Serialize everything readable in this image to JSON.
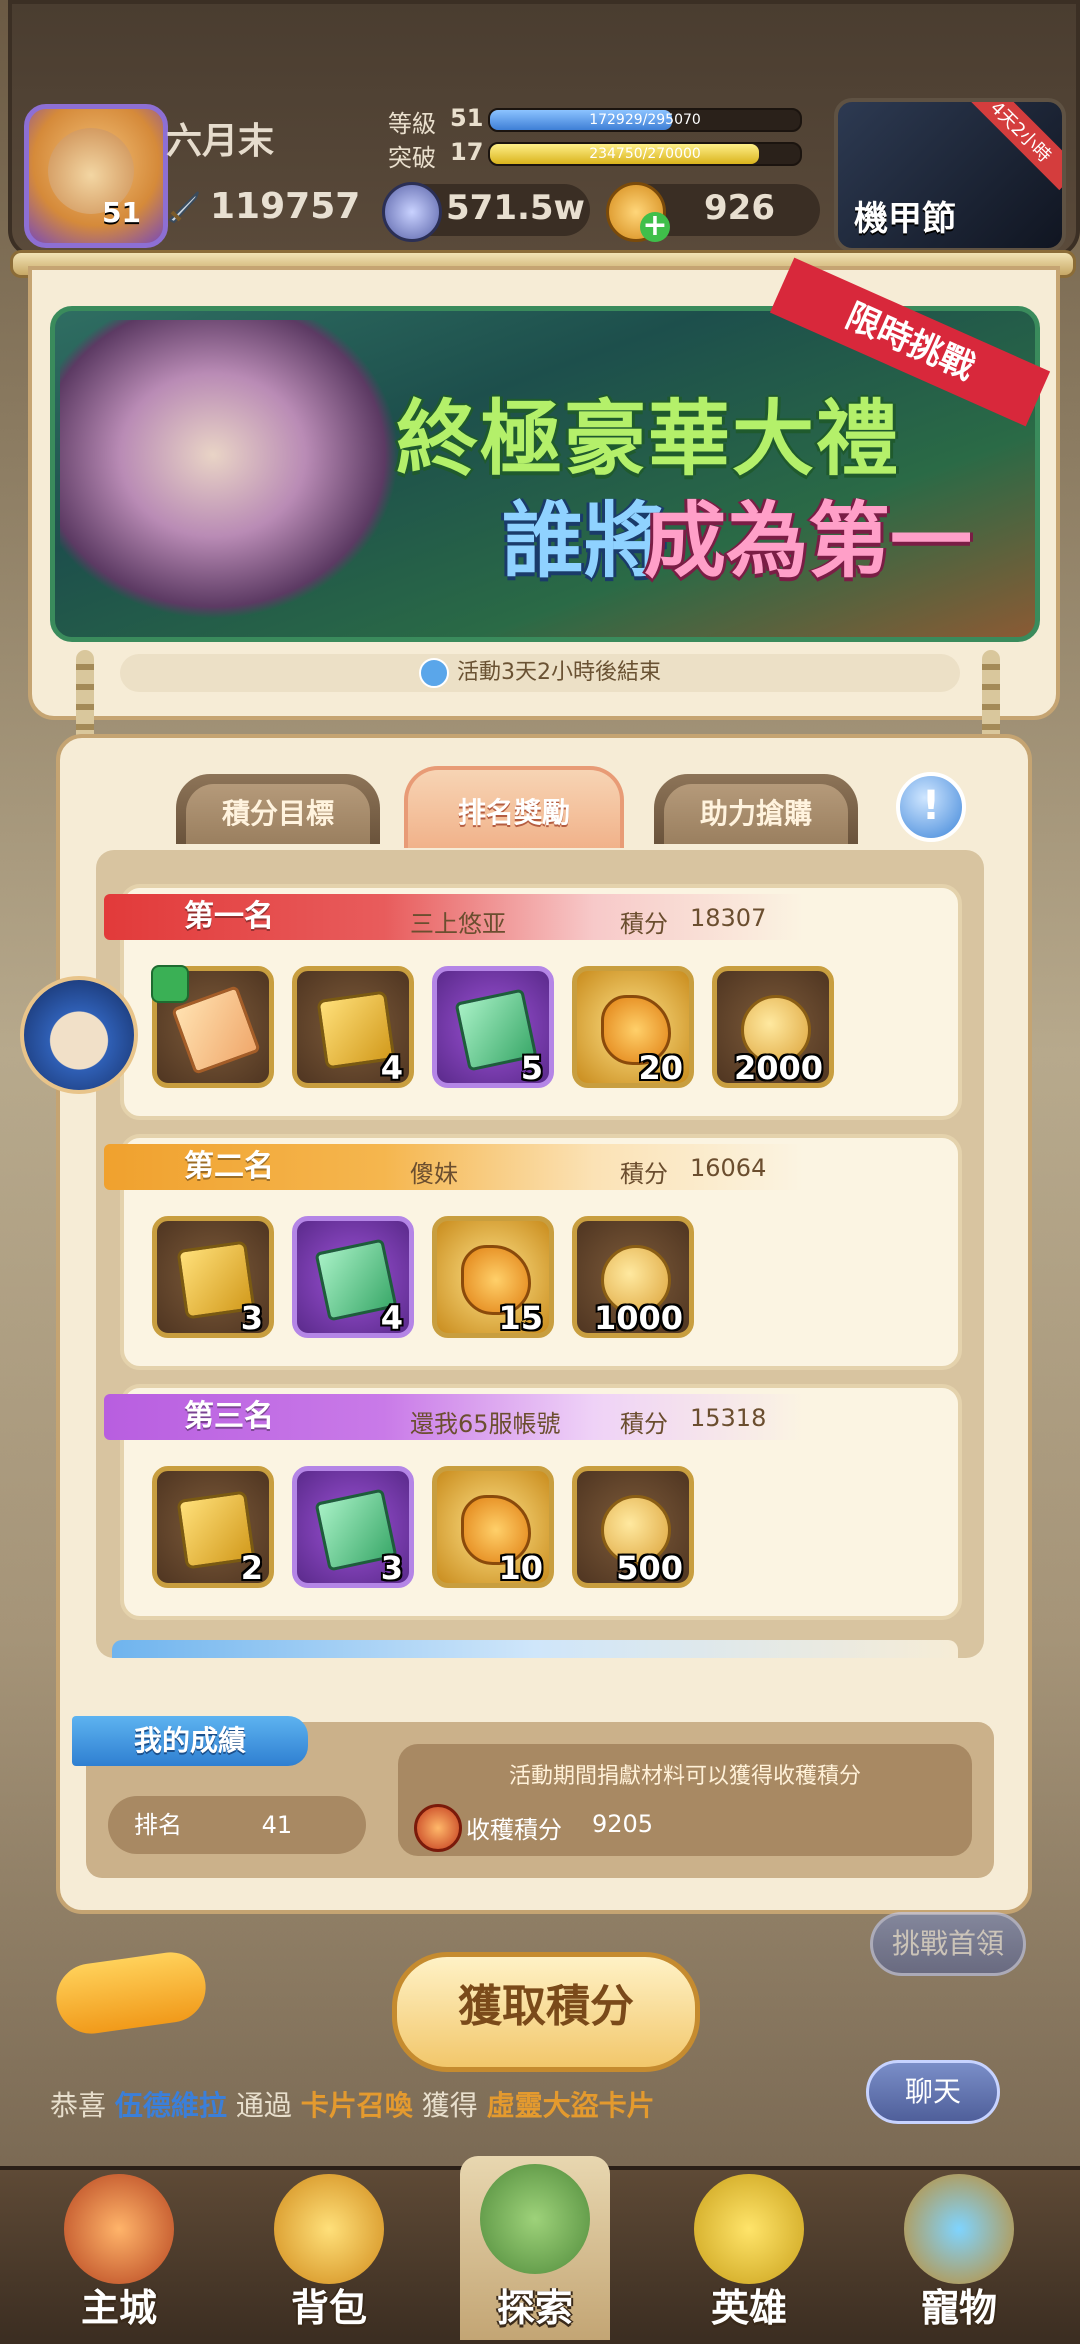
{
  "player": {
    "name": "六月末",
    "level": "51",
    "power": "119757",
    "grade_label": "等級",
    "grade_value": "51",
    "grade_progress": "172929/295070",
    "grade_fraction": 0.586,
    "break_label": "突破",
    "break_value": "17",
    "break_progress": "234750/270000",
    "break_fraction": 0.869,
    "silver": "571.5w",
    "gems": "926"
  },
  "event_box": {
    "name": "機甲節",
    "tag": "4天2小時"
  },
  "banner": {
    "ribbon": "限時挑戰",
    "title_line1": "終極豪華大禮",
    "title_line2a": "誰將",
    "title_line2b": "成為第一",
    "timer": "活動3天2小時後結束"
  },
  "tabs": [
    {
      "label": "積分目標"
    },
    {
      "label": "排名獎勵",
      "active": true
    },
    {
      "label": "助力搶購"
    }
  ],
  "info_button": "!",
  "ranks": [
    {
      "title": "第一名",
      "player": "三上悠亚",
      "score_label": "積分",
      "score": "18307",
      "color": "#e23a3a",
      "items": [
        {
          "icon": "voucher-icon",
          "qty": "",
          "style": "brown",
          "timed": true
        },
        {
          "icon": "gold-card-icon",
          "qty": "4",
          "style": "brown"
        },
        {
          "icon": "green-ticket-icon",
          "qty": "5",
          "style": "purple"
        },
        {
          "icon": "orange-shard-icon",
          "qty": "20",
          "style": "gold"
        },
        {
          "icon": "gold-coins-icon",
          "qty": "2000",
          "style": "brown"
        }
      ]
    },
    {
      "title": "第二名",
      "player": "傻妹",
      "score_label": "積分",
      "score": "16064",
      "color": "#f0a12e",
      "items": [
        {
          "icon": "gold-card-icon",
          "qty": "3",
          "style": "brown"
        },
        {
          "icon": "green-ticket-icon",
          "qty": "4",
          "style": "purple"
        },
        {
          "icon": "orange-shard-icon",
          "qty": "15",
          "style": "gold"
        },
        {
          "icon": "gold-coins-icon",
          "qty": "1000",
          "style": "brown"
        }
      ]
    },
    {
      "title": "第三名",
      "player": "還我65服帳號",
      "score_label": "積分",
      "score": "15318",
      "color": "#b85ee0",
      "items": [
        {
          "icon": "gold-card-icon",
          "qty": "2",
          "style": "brown"
        },
        {
          "icon": "green-ticket-icon",
          "qty": "3",
          "style": "purple"
        },
        {
          "icon": "orange-shard-icon",
          "qty": "10",
          "style": "gold"
        },
        {
          "icon": "gold-coins-icon",
          "qty": "500",
          "style": "brown"
        }
      ]
    }
  ],
  "my_result": {
    "label": "我的成績",
    "rank_label": "排名",
    "rank_value": "41",
    "hint": "活動期間捐獻材料可以獲得收穫積分",
    "points_label": "收穫積分",
    "points_value": "9205"
  },
  "get_points_button": "獲取積分",
  "ticker": {
    "prefix": "恭喜",
    "player": "伍德維拉",
    "verb": "通過",
    "source": "卡片召喚",
    "gain": "獲得",
    "reward": "虛靈大盜卡片"
  },
  "side_buttons": {
    "challenge": "挑戰首領",
    "chat": "聊天"
  },
  "nav": [
    {
      "label": "主城",
      "icon": "castle-icon"
    },
    {
      "label": "背包",
      "icon": "backpack-icon"
    },
    {
      "label": "探索",
      "icon": "map-scroll-icon"
    },
    {
      "label": "英雄",
      "icon": "hero-icon"
    },
    {
      "label": "寵物",
      "icon": "pet-icon"
    }
  ],
  "colors": {
    "panel": "#f6ecd6",
    "tab_active": "#f1b28a",
    "my_label": "#2f7fd1"
  }
}
